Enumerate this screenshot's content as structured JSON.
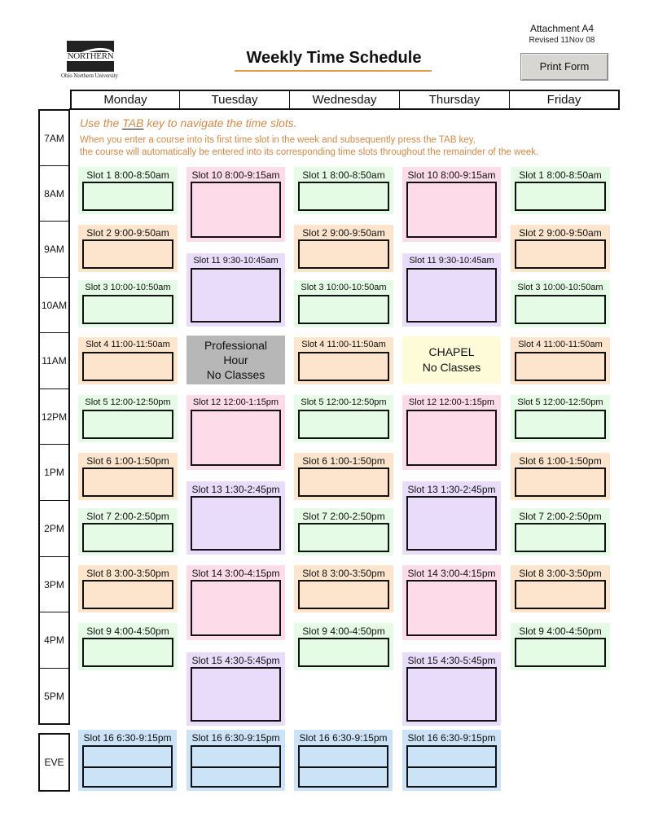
{
  "header": {
    "logo_word": "NORTHERN",
    "logo_subtitle": "Ohio Northern University",
    "title": "Weekly Time Schedule",
    "attachment": "Attachment A4",
    "revised": "Revised 11Nov 08",
    "print_button": "Print Form"
  },
  "days": [
    "Monday",
    "Tuesday",
    "Wednesday",
    "Thursday",
    "Friday"
  ],
  "times": [
    "7AM",
    "8AM",
    "9AM",
    "10AM",
    "11AM",
    "12PM",
    "1PM",
    "2PM",
    "3PM",
    "4PM",
    "5PM"
  ],
  "evening_label": "EVE",
  "instructions": {
    "line1_pre": "Use the ",
    "line1_key": "TAB",
    "line1_post": " key to navigate the time slots.",
    "line2": "When you enter a course into its first time slot in the week and subsequently press the TAB key,",
    "line3": "the course will automatically be entered into its corresponding time slots throughout the remainder of the week."
  },
  "mwf_slots": [
    {
      "label": "Slot 1 8:00-8:50am",
      "color": "green",
      "value": ""
    },
    {
      "label": "Slot 2 9:00-9:50am",
      "color": "orange",
      "value": ""
    },
    {
      "label": "Slot 3 10:00-10:50am",
      "color": "green",
      "value": ""
    },
    {
      "label": "Slot 4 11:00-11:50am",
      "color": "orange",
      "value": ""
    },
    {
      "label": "Slot 5 12:00-12:50pm",
      "color": "green",
      "value": ""
    },
    {
      "label": "Slot 6 1:00-1:50pm",
      "color": "orange",
      "value": ""
    },
    {
      "label": "Slot 7 2:00-2:50pm",
      "color": "green",
      "value": ""
    },
    {
      "label": "Slot 8 3:00-3:50pm",
      "color": "orange",
      "value": ""
    },
    {
      "label": "Slot 9 4:00-4:50pm",
      "color": "green",
      "value": ""
    }
  ],
  "tr_slots": [
    {
      "label": "Slot 10 8:00-9:15am",
      "color": "pink",
      "value": ""
    },
    {
      "label": "Slot 11 9:30-10:45am",
      "color": "purple",
      "value": ""
    },
    {
      "label": "Slot 12 12:00-1:15pm",
      "color": "pink",
      "value": ""
    },
    {
      "label": "Slot 13 1:30-2:45pm",
      "color": "purple",
      "value": ""
    },
    {
      "label": "Slot 14 3:00-4:15pm",
      "color": "pink",
      "value": ""
    },
    {
      "label": "Slot 15 4:30-5:45pm",
      "color": "purple",
      "value": ""
    }
  ],
  "evening_slot": {
    "label": "Slot 16 6:30-9:15pm",
    "color": "blue",
    "days": [
      "Monday",
      "Tuesday",
      "Wednesday",
      "Thursday"
    ]
  },
  "tuesday_block": {
    "line1": "Professional",
    "line2": "Hour",
    "line3": "No Classes"
  },
  "thursday_block": {
    "line1": "CHAPEL",
    "line2": "No Classes"
  },
  "colors": {
    "green": "#e6fbe6",
    "orange": "#fde4cc",
    "pink": "#fddbe8",
    "purple": "#e8dcfa",
    "blue": "#cce3f7",
    "gray": "#b7b7b7",
    "yellow": "#fefbd8",
    "instruction_text": "#d08a4a",
    "title_underline": "#e09a4a"
  }
}
